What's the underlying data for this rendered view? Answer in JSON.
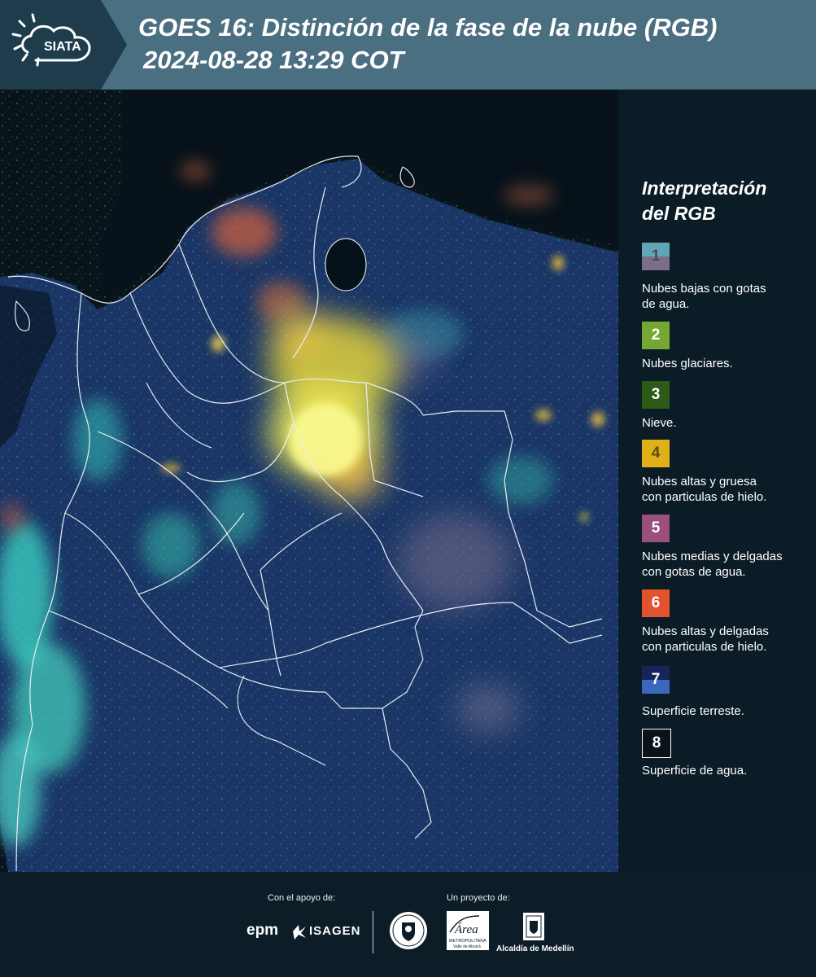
{
  "header": {
    "logo_text": "SIATA",
    "title_line1": "GOES 16: Distinción de la fase de la nube (RGB)",
    "title_line2": "2024-08-28 13:29 COT"
  },
  "legend": {
    "title_line1": "Interpretación",
    "title_line2": "del RGB",
    "items": [
      {
        "number": "1",
        "label_line1": "Nubes bajas con gotas",
        "label_line2": "de agua.",
        "color_top": "#5fa7b6",
        "color_bottom": "#7a6e8a",
        "text_color": "#4a4a5a"
      },
      {
        "number": "2",
        "label_line1": "Nubes glaciares.",
        "label_line2": "",
        "color_top": "#77a733",
        "color_bottom": "#77a733",
        "text_color": "#ffffff"
      },
      {
        "number": "3",
        "label_line1": "Nieve.",
        "label_line2": "",
        "color_top": "#2e5a17",
        "color_bottom": "#2e5a17",
        "text_color": "#ffffff"
      },
      {
        "number": "4",
        "label_line1": "Nubes altas y gruesa",
        "label_line2": "con particulas de hielo.",
        "color_top": "#e0b019",
        "color_bottom": "#e0b019",
        "text_color": "#5a4a1a"
      },
      {
        "number": "5",
        "label_line1": "Nubes medias y delgadas",
        "label_line2": "con gotas de agua.",
        "color_top": "#9b4f7b",
        "color_bottom": "#9b4f7b",
        "text_color": "#ffffff"
      },
      {
        "number": "6",
        "label_line1": "Nubes altas y delgadas",
        "label_line2": "con particulas de hielo.",
        "color_top": "#e1522e",
        "color_bottom": "#e1522e",
        "text_color": "#ffffff"
      },
      {
        "number": "7",
        "label_line1": "Superficie terreste.",
        "label_line2": "",
        "color_top": "#17245a",
        "color_bottom": "#3a68bf",
        "text_color": "#ffffff"
      },
      {
        "number": "8",
        "label_line1": "Superficie de agua.",
        "label_line2": "",
        "color_top": "#0a1418",
        "color_bottom": "#0a1418",
        "text_color": "#ffffff"
      }
    ]
  },
  "footer": {
    "support_label": "Con el apoyo de:",
    "project_label": "Un proyecto de:",
    "epm": "epm",
    "isagen": "ISAGEN",
    "area_text": "Área",
    "area_sub1": "METROPOLITANA",
    "area_sub2": "Valle de Aburrá",
    "alcaldia": "Alcaldía de Medellín"
  },
  "colors": {
    "header_bg": "#4a6f80",
    "panel_bg": "#0b1c27",
    "ocean": "#0a1418",
    "land": "#1b3a6b",
    "cloud_yellow": "#f2e84a",
    "cloud_cyan": "#3fd6c6",
    "boundary": "#e8eef2"
  }
}
